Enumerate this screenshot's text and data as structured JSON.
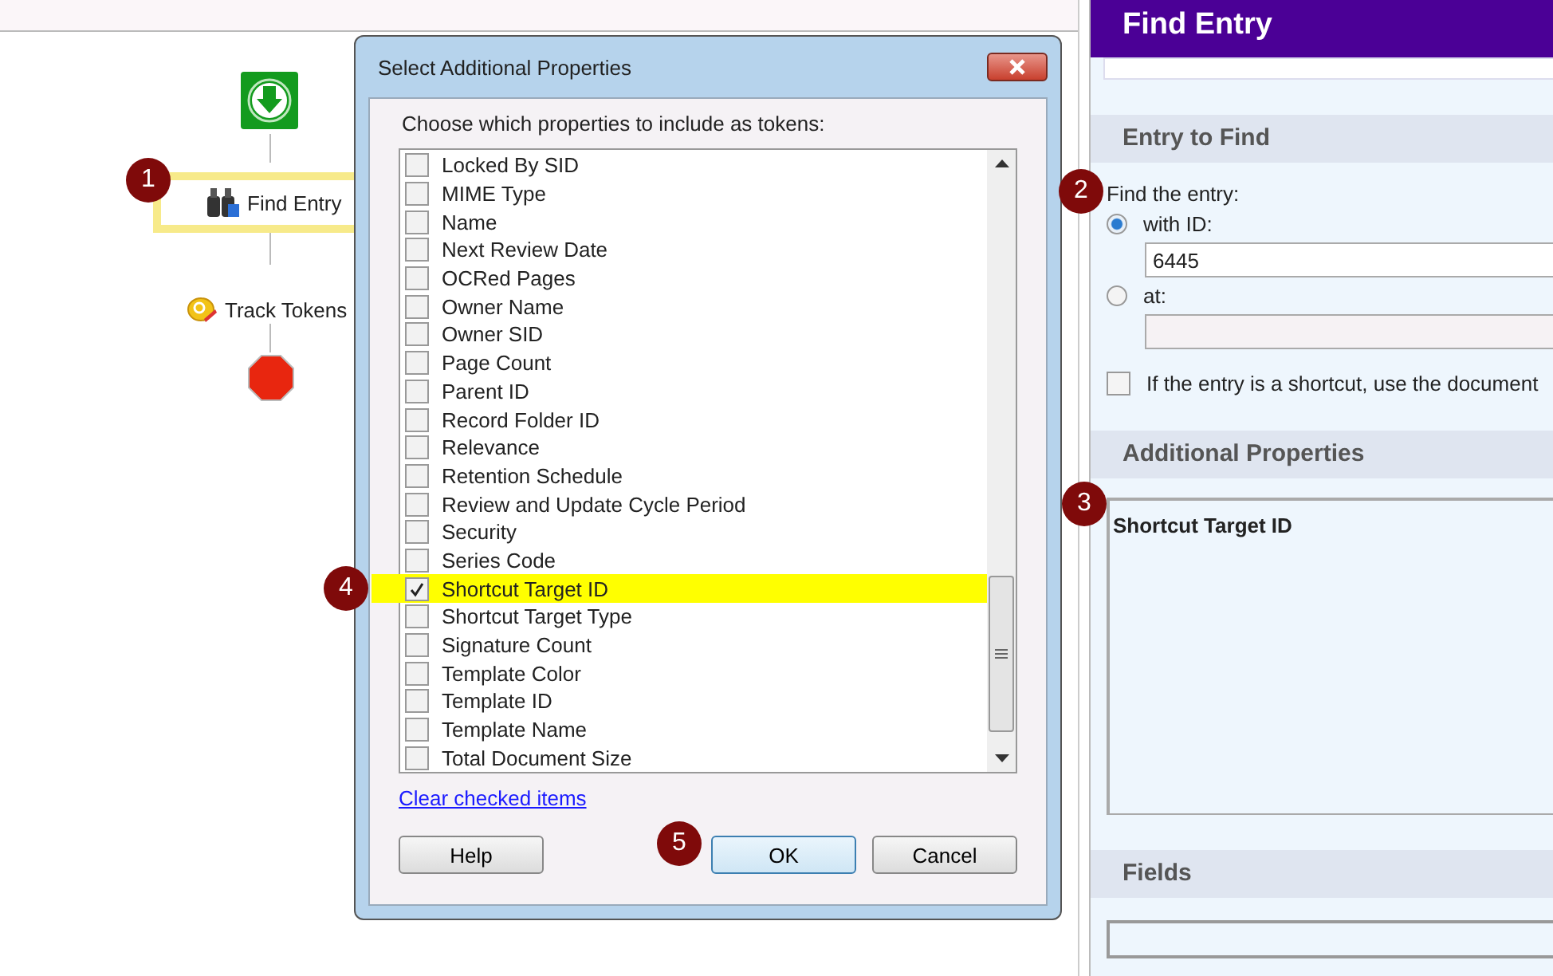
{
  "canvas": {
    "nodes": [
      {
        "kind": "start"
      },
      {
        "kind": "activity",
        "label": "Find Entry",
        "selected": true,
        "callout": "1"
      },
      {
        "kind": "activity",
        "label": "Track Tokens",
        "selected": false
      },
      {
        "kind": "stop"
      }
    ]
  },
  "dialog": {
    "title": "Select Additional Properties",
    "instruction": "Choose which properties to include as tokens:",
    "items": [
      {
        "label": "Locked By SID",
        "checked": false,
        "highlighted": false
      },
      {
        "label": "MIME Type",
        "checked": false,
        "highlighted": false
      },
      {
        "label": "Name",
        "checked": false,
        "highlighted": false
      },
      {
        "label": "Next Review Date",
        "checked": false,
        "highlighted": false
      },
      {
        "label": "OCRed Pages",
        "checked": false,
        "highlighted": false
      },
      {
        "label": "Owner Name",
        "checked": false,
        "highlighted": false
      },
      {
        "label": "Owner SID",
        "checked": false,
        "highlighted": false
      },
      {
        "label": "Page Count",
        "checked": false,
        "highlighted": false
      },
      {
        "label": "Parent ID",
        "checked": false,
        "highlighted": false
      },
      {
        "label": "Record Folder ID",
        "checked": false,
        "highlighted": false
      },
      {
        "label": "Relevance",
        "checked": false,
        "highlighted": false
      },
      {
        "label": "Retention Schedule",
        "checked": false,
        "highlighted": false
      },
      {
        "label": "Review and Update Cycle Period",
        "checked": false,
        "highlighted": false
      },
      {
        "label": "Security",
        "checked": false,
        "highlighted": false
      },
      {
        "label": "Series Code",
        "checked": false,
        "highlighted": false
      },
      {
        "label": "Shortcut Target ID",
        "checked": true,
        "highlighted": true,
        "callout": "4"
      },
      {
        "label": "Shortcut Target Type",
        "checked": false,
        "highlighted": false
      },
      {
        "label": "Signature Count",
        "checked": false,
        "highlighted": false
      },
      {
        "label": "Template Color",
        "checked": false,
        "highlighted": false
      },
      {
        "label": "Template ID",
        "checked": false,
        "highlighted": false
      },
      {
        "label": "Template Name",
        "checked": false,
        "highlighted": false
      },
      {
        "label": "Total Document Size",
        "checked": false,
        "highlighted": false
      }
    ],
    "link": "Clear checked items",
    "buttons": [
      {
        "label": "Help",
        "default": false
      },
      {
        "label": "OK",
        "default": true,
        "callout": "5"
      },
      {
        "label": "Cancel",
        "default": false
      }
    ]
  },
  "panel": {
    "title": "Find Entry",
    "entry_section": {
      "heading": "Entry to Find",
      "prompt": "Find the entry:",
      "callout": "2",
      "options": [
        {
          "label": "with ID:",
          "selected": true,
          "value": "6445"
        },
        {
          "label": "at:",
          "selected": false
        }
      ],
      "checkbox": {
        "label": "If the entry is a shortcut, use the document",
        "checked": false
      }
    },
    "properties_section": {
      "heading": "Additional Properties",
      "value": "Shortcut Target ID",
      "callout": "3"
    },
    "fields_section": {
      "heading": "Fields"
    }
  }
}
